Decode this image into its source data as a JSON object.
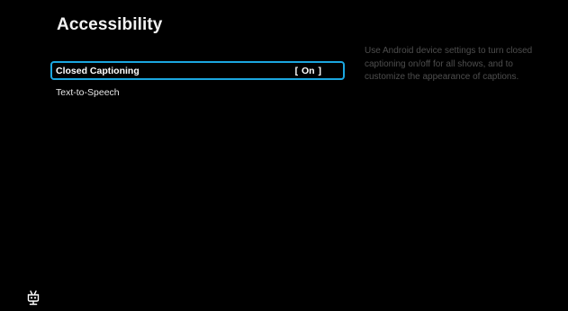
{
  "page": {
    "title": "Accessibility"
  },
  "menu": {
    "items": [
      {
        "label": "Closed Captioning",
        "value": "[ On ]",
        "selected": true
      },
      {
        "label": "Text-to-Speech",
        "value": "",
        "selected": false
      }
    ]
  },
  "description": {
    "text": "Use Android device settings to turn closed captioning on/off for all shows, and to customize the appearance of captions."
  },
  "colors": {
    "background": "#000000",
    "focus_border": "#1ba7e0",
    "description_text": "#4e4e4e"
  },
  "icons": {
    "logo": "tivo-robot-icon"
  }
}
